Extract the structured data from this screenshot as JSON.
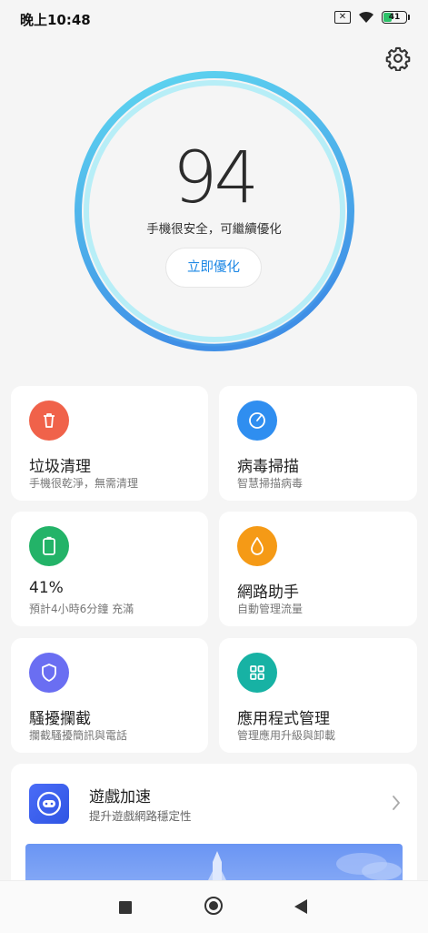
{
  "status_bar": {
    "time": "晚上10:48",
    "sim_icon": "sim-disabled-icon",
    "wifi_icon": "wifi-icon",
    "battery_level": "41",
    "battery_color": "#2ec26a"
  },
  "header": {
    "settings_icon": "gear-icon"
  },
  "score": {
    "value": "94",
    "status_text": "手機很安全，可繼續優化",
    "action_label": "立即優化",
    "ring_colors": [
      "#5fd8f0",
      "#3f8fe6"
    ]
  },
  "cards": [
    {
      "title": "垃圾清理",
      "subtitle": "手機很乾淨，無需清理",
      "icon": "trash-icon",
      "color": "#f0624a"
    },
    {
      "title": "病毒掃描",
      "subtitle": "智慧掃描病毒",
      "icon": "scan-icon",
      "color": "#2f8ef0"
    },
    {
      "title": "41%",
      "subtitle": "預計4小時6分鐘 充滿",
      "icon": "battery-icon",
      "color": "#23b368"
    },
    {
      "title": "網路助手",
      "subtitle": "自動管理流量",
      "icon": "drop-icon",
      "color": "#f59a16"
    },
    {
      "title": "騷擾攔截",
      "subtitle": "攔截騷擾簡訊與電話",
      "icon": "shield-icon",
      "color": "#6a6ef2"
    },
    {
      "title": "應用程式管理",
      "subtitle": "管理應用升級與卸載",
      "icon": "grid-icon",
      "color": "#17b2a4"
    }
  ],
  "game_booster": {
    "title": "遊戲加速",
    "subtitle": "提升遊戲網路穩定性",
    "icon": "gamepad-icon",
    "chevron_icon": "chevron-right-icon"
  },
  "nav_bar": {
    "recent_icon": "recent-apps-icon",
    "home_icon": "home-icon",
    "back_icon": "back-icon"
  }
}
